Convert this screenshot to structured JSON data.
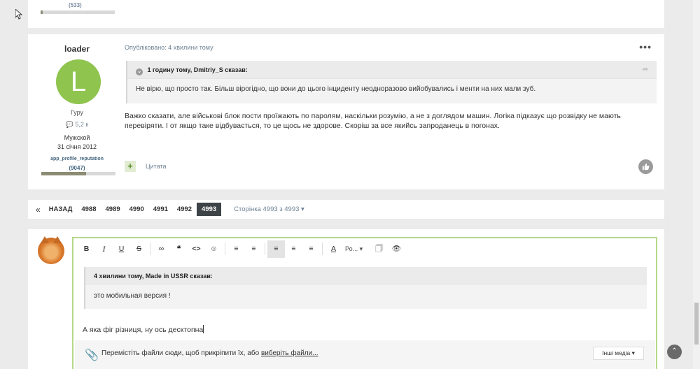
{
  "prev_post": {
    "reputation_count": "(533)"
  },
  "post": {
    "author": {
      "name": "loader",
      "avatar_letter": "L",
      "avatar_color": "#8fc44f",
      "rank": "Гуру",
      "posts_count": "5,2 к",
      "gender": "Мужской",
      "joined": "31 січня 2012",
      "reputation_label": "app_profile_reputation",
      "reputation_count": "(9047)"
    },
    "published": "Опубліковано: 4 хвилини тому",
    "quote": {
      "header": "1 годину тому, Dmitriy_S сказав:",
      "text": "Не вірю, що просто так. Більш вірогідно, що вони до цього інциденту неодноразово вийобувались і менти на них мали зуб."
    },
    "body": "Важко сказати, але військові блок пости проїжають по паролям, наскільки розумію, а не з доглядом машин. Логіка підказує що розвідку не мають перевіряти. І от якщо таке відбувається, то це щось не здорове. Скоріш за все якийсь запроданець в погонах.",
    "cite_label": "Цитата"
  },
  "pagination": {
    "prev": "«",
    "back_label": "НАЗАД",
    "pages": [
      "4988",
      "4989",
      "4990",
      "4991",
      "4992"
    ],
    "active": "4993",
    "page_of": "Сторінка 4993 з 4993"
  },
  "reply": {
    "font_label": "Ро...",
    "quote": {
      "header": "4 хвилини тому, Made in USSR сказав:",
      "text": "это мобильная версия !"
    },
    "text": "А яка фіг різниця, ну ось десктопна",
    "attach_text": "Перемістіть файли сюди, щоб прикріпити їх, або ",
    "attach_link": "виберіть файли...",
    "media_button": "Інші медіа"
  },
  "colors": {
    "accent_green": "#b5d989",
    "active_page": "#3d4346"
  }
}
